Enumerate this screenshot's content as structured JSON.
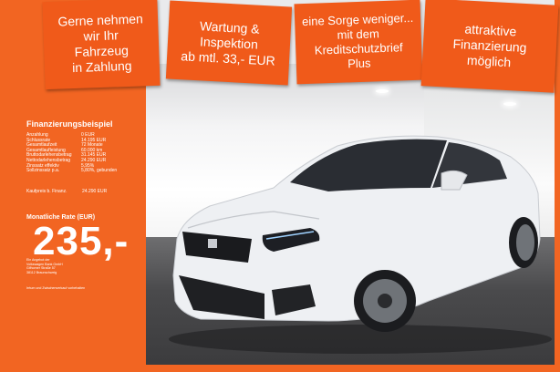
{
  "banners": [
    {
      "text": "Gerne nehmen\nwir Ihr\nFahrzeug\nin Zahlung"
    },
    {
      "text": "Wartung &\nInspektion\nab mtl. 33,- EUR"
    },
    {
      "text": "eine Sorge weniger...\nmit dem\nKreditschutzbrief\nPlus"
    },
    {
      "text": "attraktive\nFinanzierung\nmöglich"
    }
  ],
  "finance": {
    "title": "Finanzierungsbeispiel",
    "rows": [
      {
        "label": "Anzahlung",
        "value": "0 EUR"
      },
      {
        "label": "Schlussrate",
        "value": "14.195 EUR"
      },
      {
        "label": "Gesamtlaufzeit",
        "value": "72 Monate"
      },
      {
        "label": "Gesamtlaufleistung",
        "value": "60.000 km"
      },
      {
        "label": "Bruttodarlehensbetrag",
        "value": "31.145 EUR"
      },
      {
        "label": "Nettodarlehensbetrag",
        "value": "24.290 EUR"
      },
      {
        "label": "Zinssatz effektiv",
        "value": "5,95%"
      },
      {
        "label": "Sollzinssatz p.a.",
        "value": "5,80%, gebunden"
      }
    ],
    "kaufpreis_label": "Kaufpreis b. Finanz.",
    "kaufpreis_value": "24.290 EUR",
    "rate_label": "Monatliche Rate (EUR)",
    "rate_value": "235,-",
    "lender_lines": [
      "Ein Angebot der",
      "Volkswagen Bank GmbH",
      "Gifhorner Straße 57",
      "38112 Braunschweig"
    ],
    "legal_note": "Irrtum und Zwischenverkauf vorbehalten"
  },
  "colors": {
    "orange": "#f26522",
    "banner": "#f05a1a",
    "car": "#f2f3f5"
  }
}
